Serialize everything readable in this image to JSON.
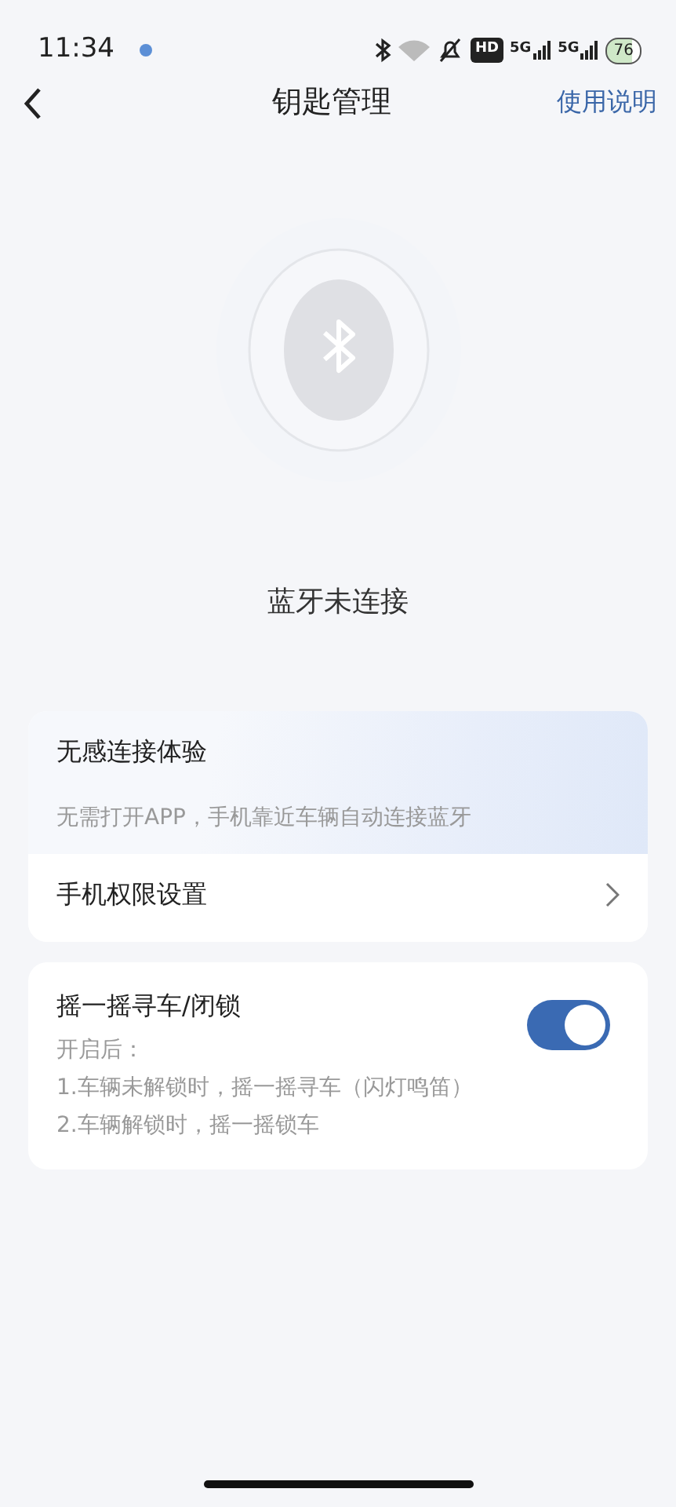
{
  "status_bar": {
    "time": "11:34",
    "hd": "HD",
    "networks": [
      "5G",
      "5G"
    ],
    "battery": "76"
  },
  "header": {
    "title": "钥匙管理",
    "action": "使用说明"
  },
  "key": {
    "status": "蓝牙未连接",
    "connected": false
  },
  "card_1": {
    "title": "无感连接体验",
    "description": "无需打开APP，手机靠近车辆自动连接蓝牙",
    "link": "手机权限设置"
  },
  "card_2": {
    "title": "摇一摇寻车/闭锁",
    "on": true,
    "lines": [
      "开启后：",
      "1.车辆未解锁时，摇一摇寻车（闪灯鸣笛）",
      "2.车辆解锁时，摇一摇锁车"
    ]
  }
}
